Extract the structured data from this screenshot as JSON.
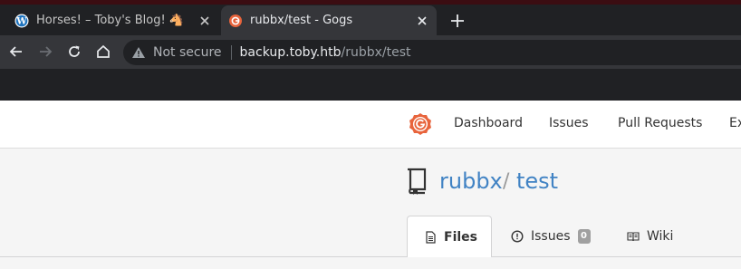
{
  "browser": {
    "tabs": [
      {
        "title": "Horses! – Toby's Blog! 🐴",
        "favicon": "wordpress-icon"
      },
      {
        "title": "rubbx/test - Gogs",
        "favicon": "gogs-icon"
      }
    ],
    "address": {
      "security_label": "Not secure",
      "host": "backup.toby.htb",
      "path": "/rubbx/test"
    }
  },
  "site": {
    "nav": {
      "dashboard": "Dashboard",
      "issues": "Issues",
      "pull_requests": "Pull Requests",
      "explore": "Explore"
    }
  },
  "repo": {
    "owner": "rubbx",
    "separator": "/",
    "name": "test",
    "tabs": {
      "files": "Files",
      "issues": "Issues",
      "issues_count": "0",
      "wiki": "Wiki"
    }
  },
  "colors": {
    "chrome_bg": "#202124",
    "active_tab_bg": "#35363a",
    "link_blue": "#4183c4",
    "gogs_orange": "#e8643c"
  }
}
